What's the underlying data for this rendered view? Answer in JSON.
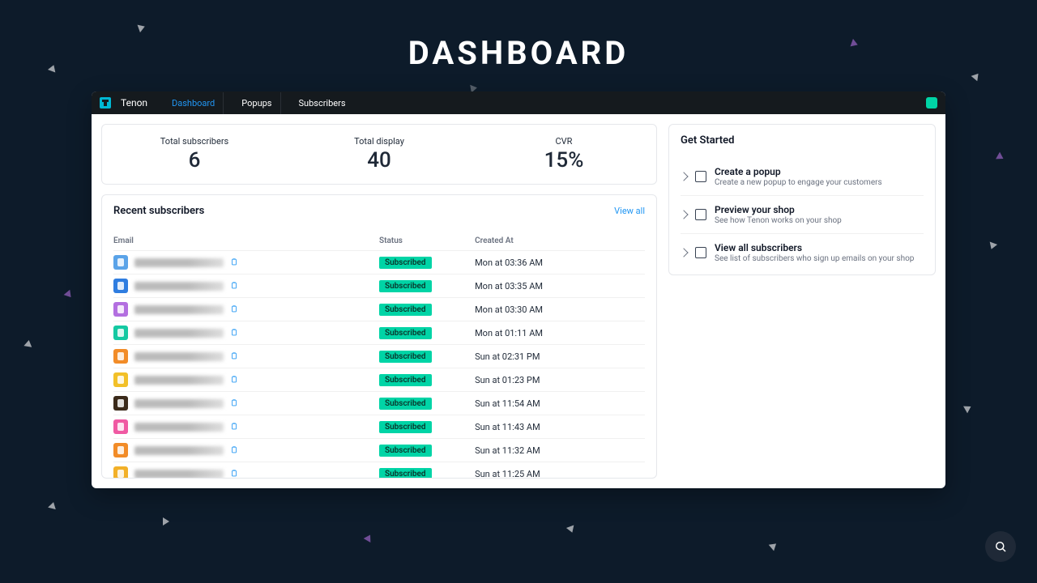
{
  "page_title": "DASHBOARD",
  "brand": "Tenon",
  "nav": [
    {
      "label": "Dashboard",
      "active": true
    },
    {
      "label": "Popups",
      "active": false
    },
    {
      "label": "Subscribers",
      "active": false
    }
  ],
  "stats": [
    {
      "label": "Total subscribers",
      "value": "6"
    },
    {
      "label": "Total display",
      "value": "40"
    },
    {
      "label": "CVR",
      "value": "15%"
    }
  ],
  "recent": {
    "title": "Recent subscribers",
    "view_all": "View all",
    "columns": {
      "email": "Email",
      "status": "Status",
      "created": "Created At"
    },
    "rows": [
      {
        "avatar_color": "#5aa3e8",
        "status": "Subscribed",
        "created": "Mon at 03:36 AM"
      },
      {
        "avatar_color": "#2f7de0",
        "status": "Subscribed",
        "created": "Mon at 03:35 AM"
      },
      {
        "avatar_color": "#b36fe0",
        "status": "Subscribed",
        "created": "Mon at 03:30 AM"
      },
      {
        "avatar_color": "#14c9a2",
        "status": "Subscribed",
        "created": "Mon at 01:11 AM"
      },
      {
        "avatar_color": "#f28c28",
        "status": "Subscribed",
        "created": "Sun at 02:31 PM"
      },
      {
        "avatar_color": "#f2c028",
        "status": "Subscribed",
        "created": "Sun at 01:23 PM"
      },
      {
        "avatar_color": "#3b2a1a",
        "status": "Subscribed",
        "created": "Sun at 11:54 AM"
      },
      {
        "avatar_color": "#f05aa3",
        "status": "Subscribed",
        "created": "Sun at 11:43 AM"
      },
      {
        "avatar_color": "#f28c28",
        "status": "Subscribed",
        "created": "Sun at 11:32 AM"
      },
      {
        "avatar_color": "#f2b028",
        "status": "Subscribed",
        "created": "Sun at 11:25 AM"
      }
    ]
  },
  "get_started": {
    "title": "Get Started",
    "items": [
      {
        "title": "Create a popup",
        "subtitle": "Create a new popup to engage your customers"
      },
      {
        "title": "Preview your shop",
        "subtitle": "See how Tenon works on your shop"
      },
      {
        "title": "View all subscribers",
        "subtitle": "See list of subscribers who sign up emails on your shop"
      }
    ]
  }
}
